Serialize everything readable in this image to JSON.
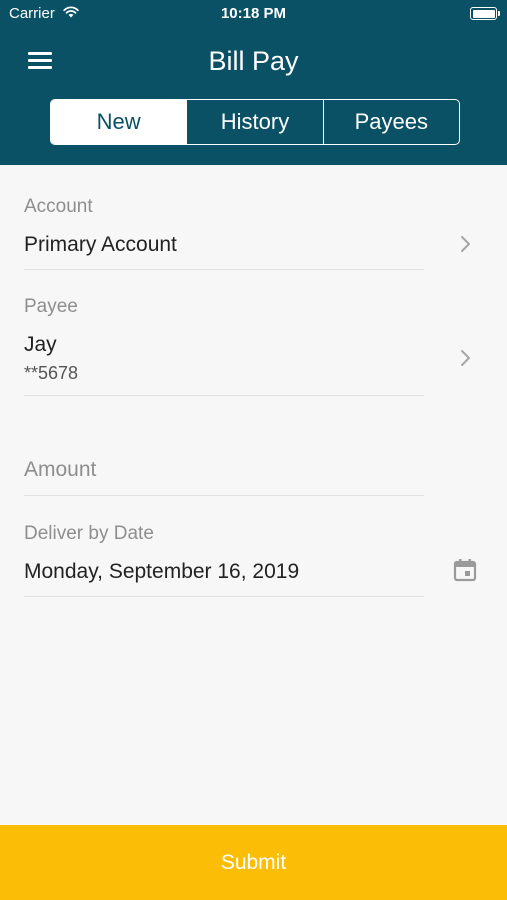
{
  "status_bar": {
    "carrier": "Carrier",
    "time": "10:18 PM"
  },
  "header": {
    "title": "Bill Pay"
  },
  "tabs": [
    {
      "label": "New",
      "active": true
    },
    {
      "label": "History",
      "active": false
    },
    {
      "label": "Payees",
      "active": false
    }
  ],
  "form": {
    "account": {
      "label": "Account",
      "value": "Primary Account"
    },
    "payee": {
      "label": "Payee",
      "name": "Jay",
      "account_masked": "**5678"
    },
    "amount": {
      "placeholder": "Amount"
    },
    "deliver_by": {
      "label": "Deliver by Date",
      "value": "Monday, September 16, 2019"
    }
  },
  "submit_label": "Submit",
  "colors": {
    "header": "#0a5166",
    "accent": "#fbbd06",
    "background": "#f7f7f7"
  },
  "icons": [
    "wifi-icon",
    "battery-icon",
    "menu-icon",
    "chevron-right-icon",
    "calendar-icon"
  ]
}
